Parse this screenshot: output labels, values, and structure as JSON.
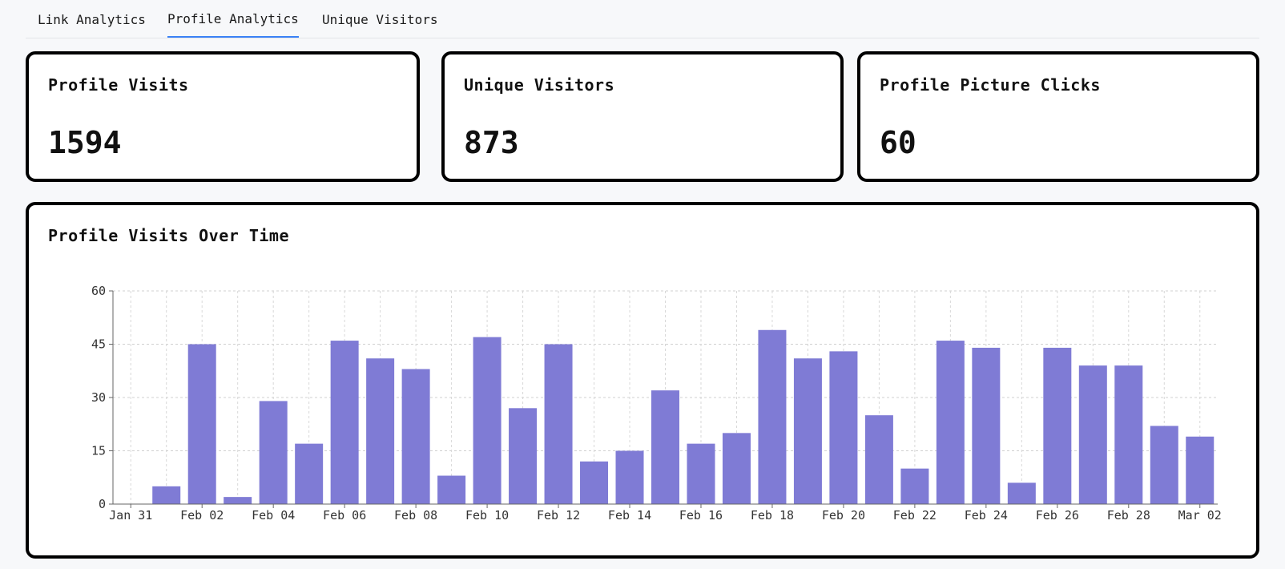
{
  "tabs": {
    "link": "Link Analytics",
    "profile": "Profile Analytics",
    "visitors": "Unique Visitors",
    "active": "profile",
    "active_color": "#3b82f6"
  },
  "stats": [
    {
      "title": "Profile Visits",
      "value": "1594"
    },
    {
      "title": "Unique Visitors",
      "value": "873"
    },
    {
      "title": "Profile Picture Clicks",
      "value": "60"
    }
  ],
  "chart": {
    "title": "Profile Visits Over Time"
  },
  "chart_data": {
    "type": "bar",
    "x": [
      "Jan 31",
      "Feb 01",
      "Feb 02",
      "Feb 03",
      "Feb 04",
      "Feb 05",
      "Feb 06",
      "Feb 07",
      "Feb 08",
      "Feb 09",
      "Feb 10",
      "Feb 11",
      "Feb 12",
      "Feb 13",
      "Feb 14",
      "Feb 15",
      "Feb 16",
      "Feb 17",
      "Feb 18",
      "Feb 19",
      "Feb 20",
      "Feb 21",
      "Feb 22",
      "Feb 23",
      "Feb 24",
      "Feb 25",
      "Feb 26",
      "Feb 27",
      "Feb 28",
      "Mar 01",
      "Mar 02"
    ],
    "values": [
      0,
      5,
      45,
      2,
      29,
      17,
      46,
      41,
      38,
      8,
      47,
      27,
      45,
      12,
      15,
      32,
      17,
      20,
      49,
      41,
      43,
      25,
      10,
      46,
      44,
      6,
      44,
      39,
      39,
      22,
      19
    ],
    "tick_labels": [
      "Jan 31",
      "Feb 02",
      "Feb 04",
      "Feb 06",
      "Feb 08",
      "Feb 10",
      "Feb 12",
      "Feb 14",
      "Feb 16",
      "Feb 18",
      "Feb 20",
      "Feb 22",
      "Feb 24",
      "Feb 26",
      "Feb 28",
      "Mar 02"
    ],
    "yticks": [
      0,
      15,
      30,
      45,
      60
    ],
    "ylim": [
      0,
      60
    ],
    "grid": true,
    "bar_color": "#7f7bd5",
    "title": "Profile Visits Over Time",
    "xlabel": "",
    "ylabel": ""
  }
}
